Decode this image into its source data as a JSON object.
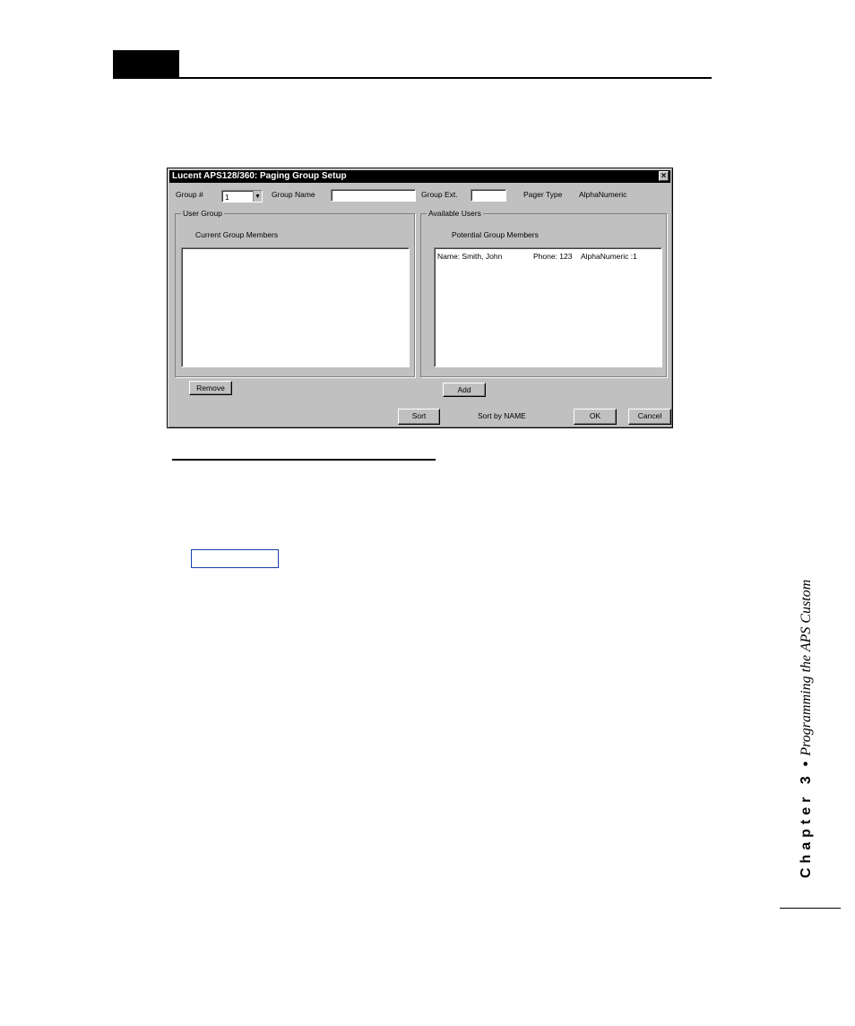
{
  "dialog": {
    "title": "Lucent APS128/360: Paging Group Setup",
    "close_symbol": "×",
    "group_number_label": "Group #",
    "group_number_value": "1",
    "group_name_label": "Group Name",
    "group_name_value": "",
    "group_ext_label": "Group Ext.",
    "group_ext_value": "",
    "pager_type_label": "Pager Type",
    "pager_type_value": "AlphaNumeric",
    "user_group": {
      "title": "User Group",
      "list_label": "Current Group Members",
      "members": []
    },
    "available_users": {
      "title": "Available Users",
      "list_label": "Potential Group Members",
      "members": [
        {
          "name": "Name: Smith, John",
          "phone": "Phone: 123",
          "type": "AlphaNumeric :1"
        }
      ]
    },
    "buttons": {
      "remove": "Remove",
      "add": "Add",
      "sort": "Sort",
      "ok": "OK",
      "cancel": "Cancel"
    },
    "sort_status": "Sort by NAME"
  },
  "sidebar": {
    "chapter": "Chapter 3",
    "separator": "•",
    "subtitle": "Programming the APS Custom"
  }
}
